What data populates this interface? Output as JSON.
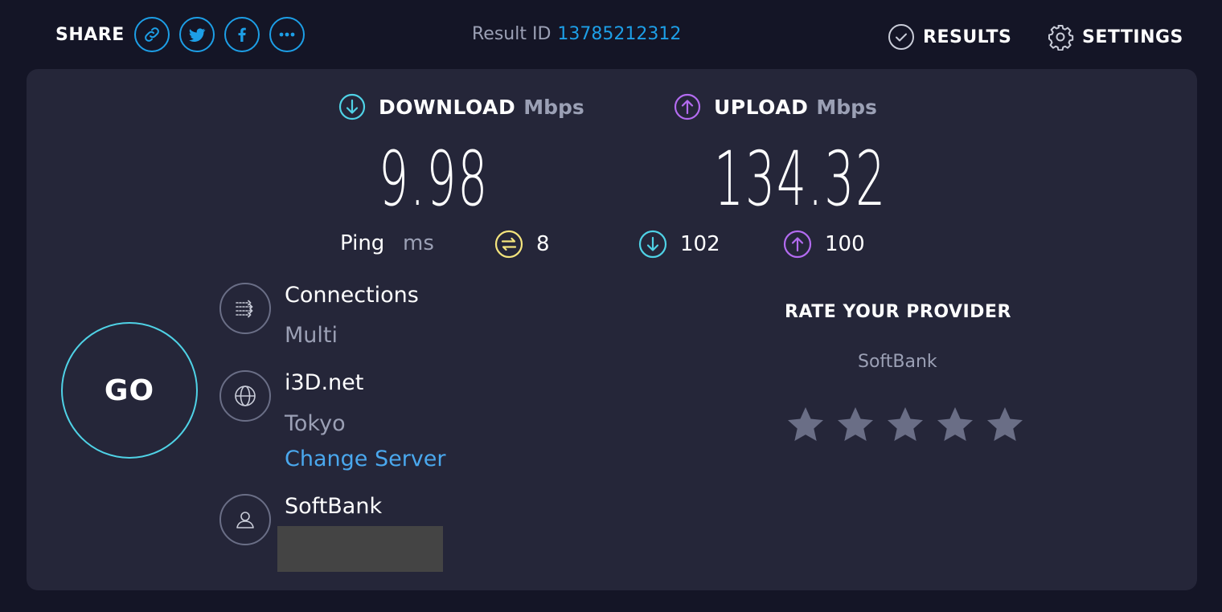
{
  "header": {
    "share_label": "SHARE",
    "share_buttons": [
      "link-icon",
      "twitter-icon",
      "facebook-icon",
      "more-icon"
    ],
    "result_id_label": "Result ID",
    "result_id_value": "13785212312",
    "results_label": "RESULTS",
    "settings_label": "SETTINGS"
  },
  "download": {
    "title": "DOWNLOAD",
    "unit": "Mbps",
    "value": "9.98"
  },
  "upload": {
    "title": "UPLOAD",
    "unit": "Mbps",
    "value": "134.32"
  },
  "ping": {
    "label": "Ping",
    "unit": "ms",
    "idle": "8",
    "download": "102",
    "upload": "100"
  },
  "go": {
    "label": "GO"
  },
  "connections": {
    "title": "Connections",
    "value": "Multi"
  },
  "server": {
    "name": "i3D.net",
    "location": "Tokyo",
    "change_label": "Change Server"
  },
  "provider": {
    "name": "SoftBank"
  },
  "rate": {
    "title": "RATE YOUR PROVIDER",
    "provider": "SoftBank",
    "stars_total": 5,
    "stars_selected": 0
  },
  "colors": {
    "accent": "#1d9fe7",
    "download": "#4fd2e6",
    "upload": "#b36bf0",
    "idle": "#f4e47d",
    "star": "#6a6e86"
  }
}
